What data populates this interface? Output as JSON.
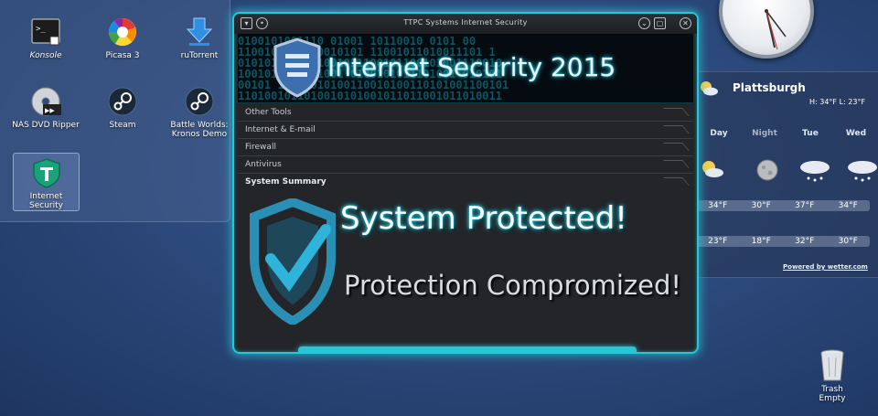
{
  "desktop": {
    "icons": [
      {
        "label": "Konsole",
        "icon": "terminal-icon"
      },
      {
        "label": "Picasa 3",
        "icon": "picasa-icon"
      },
      {
        "label": "ruTorrent",
        "icon": "download-arrow-icon"
      },
      {
        "label": "NAS DVD Ripper",
        "icon": "dvd-disc-icon"
      },
      {
        "label": "Steam",
        "icon": "steam-icon"
      },
      {
        "label": "Battle Worlds: Kronos Demo",
        "icon": "steam-icon"
      },
      {
        "label": "Internet Security",
        "icon": "shield-t-icon"
      }
    ],
    "trash": {
      "label": "Trash Empty",
      "icon": "trash-icon"
    }
  },
  "weather": {
    "city": "Plattsburgh",
    "hilo": "H: 34°F L: 23°F",
    "days": [
      "Day",
      "Night",
      "Tue",
      "Wed"
    ],
    "highs": [
      "34°F",
      "30°F",
      "37°F",
      "34°F"
    ],
    "lows": [
      "23°F",
      "18°F",
      "32°F",
      "30°F"
    ],
    "icons": [
      "partly-sunny-icon",
      "moon-icon",
      "snow-cloud-icon",
      "snow-cloud-icon"
    ],
    "powered": "Powered by wetter.com"
  },
  "app": {
    "window_title": "TTPC Systems Internet Security",
    "banner_title": "Internet Security 2015",
    "menu": [
      "Other Tools",
      "Internet & E-mail",
      "Firewall",
      "Antivirus",
      "System Summary"
    ],
    "status_primary": "System Protected!",
    "status_secondary": "Protection Compromized!",
    "accent_color": "#27c7d8"
  }
}
